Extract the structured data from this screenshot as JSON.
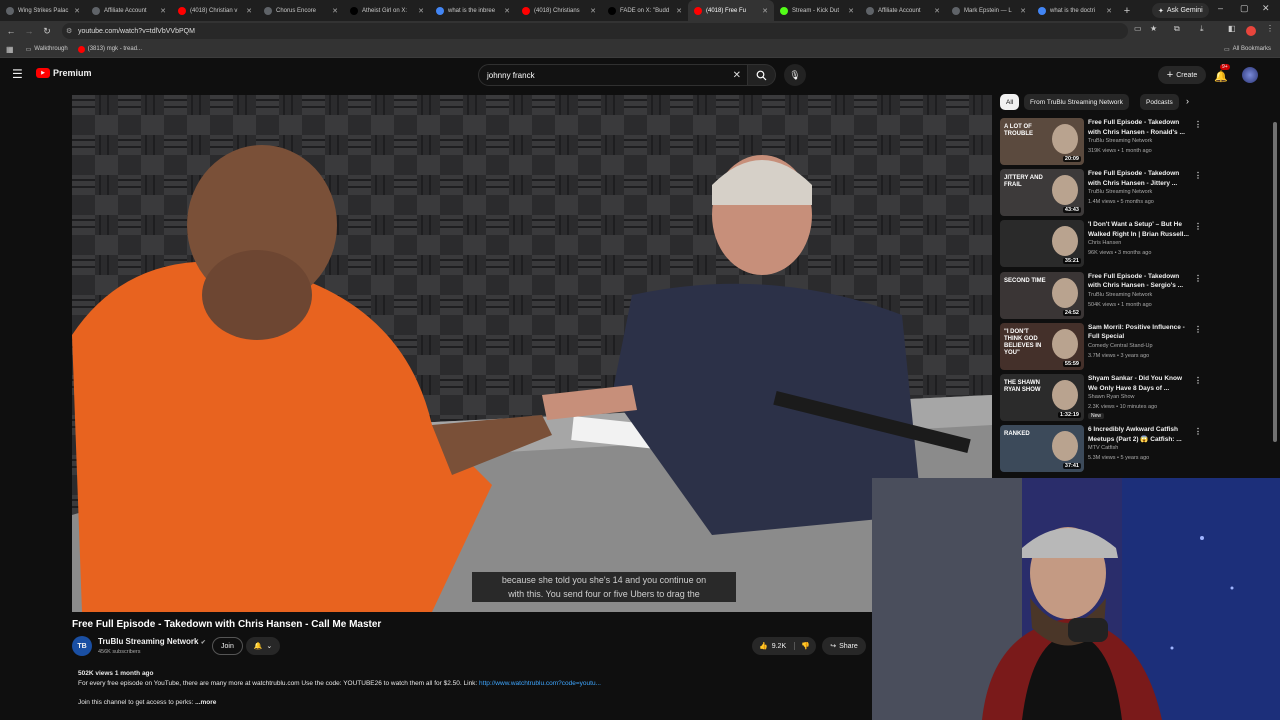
{
  "browser": {
    "tabs": [
      {
        "title": "Wing Strikes Palac",
        "color": "#5f6368"
      },
      {
        "title": "Affiliate Account",
        "color": "#5f6368"
      },
      {
        "title": "(4018) Christian v",
        "color": "#ff0000"
      },
      {
        "title": "Chorus Encore",
        "color": "#5f6368"
      },
      {
        "title": "Atheist Girl on X:",
        "color": "#000000"
      },
      {
        "title": "what is the inbree",
        "color": "#4285f4"
      },
      {
        "title": "(4018) Christians",
        "color": "#ff0000"
      },
      {
        "title": "FADE on X: \"Budd",
        "color": "#000000"
      },
      {
        "title": "(4018) Free Fu",
        "color": "#ff0000"
      },
      {
        "title": "Stream - Kick Dut",
        "color": "#53fc18"
      },
      {
        "title": "Affiliate Account",
        "color": "#5f6368"
      },
      {
        "title": "Mark Epstein — L",
        "color": "#5f6368"
      },
      {
        "title": "what is the doctri",
        "color": "#4285f4"
      }
    ],
    "ask_gemini": "Ask Gemini",
    "url": "youtube.com/watch?v=tdlVbVVbPQM",
    "bookmarks": [
      "Walkthrough",
      "(3813) mgk - tread..."
    ],
    "all_bookmarks": "All Bookmarks"
  },
  "youtube": {
    "logo_text": "Premium",
    "search_value": "johnny franck",
    "create_label": "Create",
    "notif_count": "9+",
    "caption_lines": [
      "because she told you she's 14 and you continue on",
      "with this. You send four or five Ubers to drag the"
    ],
    "video_title": "Free Full Episode - Takedown with Chris Hansen - Call Me Master",
    "channel": {
      "name": "TruBlu Streaming Network",
      "subscribers": "456K subscribers",
      "avatar_text": "TB"
    },
    "join_label": "Join",
    "likes": "9.2K",
    "share_label": "Share",
    "description": {
      "meta": "502K views  1 month ago",
      "line1": "For every free episode on YouTube, there are many more at watchtrublu.com  Use the code: YOUTUBE26 to watch them all for $2.50.  Link: ",
      "link": "http://www.watchtrublu.com?code=youtu...",
      "line2": "Join this channel to get access to perks:",
      "more": "...more"
    },
    "chips": [
      "All",
      "From TruBlu Streaming Network",
      "Podcasts"
    ],
    "recommendations": [
      {
        "title": "Free Full Episode - Takedown with Chris Hansen - Ronald's ...",
        "channel": "TruBlu Streaming Network",
        "views": "319K views • 1 month ago",
        "duration": "20:09",
        "thumb_text": "A LOT OF TROUBLE",
        "new": ""
      },
      {
        "title": "Free Full Episode - Takedown with Chris Hansen - Jittery ...",
        "channel": "TruBlu Streaming Network",
        "views": "1.4M views • 5 months ago",
        "duration": "43:43",
        "thumb_text": "JITTERY AND FRAIL",
        "new": ""
      },
      {
        "title": "'I Don't Want a Setup' – But He Walked Right In | Brian Russell...",
        "channel": "Chris Hansen",
        "views": "96K views • 3 months ago",
        "duration": "35:21",
        "thumb_text": "",
        "new": ""
      },
      {
        "title": "Free Full Episode - Takedown with Chris Hansen - Sergio's ...",
        "channel": "TruBlu Streaming Network",
        "views": "504K views • 1 month ago",
        "duration": "24:52",
        "thumb_text": "SECOND TIME",
        "new": ""
      },
      {
        "title": "Sam Morril: Positive Influence - Full Special",
        "channel": "Comedy Central Stand-Up",
        "views": "3.7M views • 3 years ago",
        "duration": "55:59",
        "thumb_text": "\"I DON'T THINK GOD BELIEVES IN YOU\"",
        "new": ""
      },
      {
        "title": "Shyam Sankar - Did You Know We Only Have 8 Days of ...",
        "channel": "Shawn Ryan Show",
        "views": "2.3K views • 10 minutes ago",
        "duration": "1:32:19",
        "thumb_text": "THE SHAWN RYAN SHOW",
        "new": "New"
      },
      {
        "title": "6 Incredibly Awkward Catfish Meetups (Part 2) 😱 Catfish: ...",
        "channel": "MTV Catfish",
        "views": "5.3M views • 5 years ago",
        "duration": "37:41",
        "thumb_text": "RANKED",
        "new": ""
      }
    ]
  },
  "colors": {
    "accent": "#ff0000",
    "link": "#3ea6ff",
    "bg": "#0f0f0f"
  }
}
